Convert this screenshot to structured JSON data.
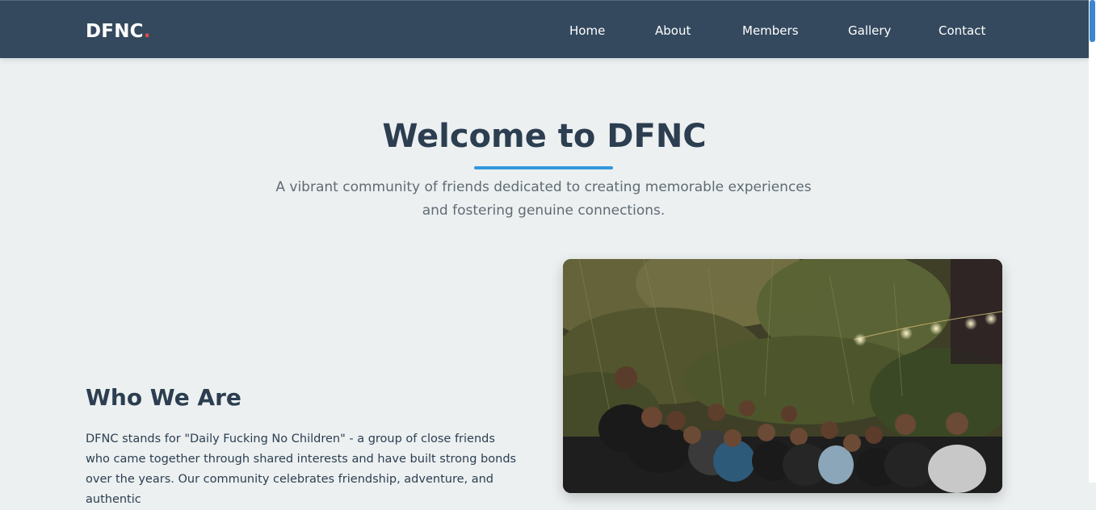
{
  "nav": {
    "logo_text": "DFNC",
    "logo_dot": ".",
    "links": [
      "Home",
      "About",
      "Members",
      "Gallery",
      "Contact"
    ]
  },
  "hero": {
    "title": "Welcome to DFNC",
    "subtitle": "A vibrant community of friends dedicated to creating memorable experiences and fostering genuine connections."
  },
  "about": {
    "heading": "Who We Are",
    "body": "DFNC stands for \"Daily Fucking No Children\" - a group of close friends who came together through shared interests and have built strong bonds over the years. Our community celebrates friendship, adventure, and authentic"
  },
  "colors": {
    "navbar": "#34495e",
    "accent": "#3498db",
    "logo_dot": "#e74c3c",
    "page_bg": "#ecf0f1",
    "heading": "#2c3e50"
  }
}
